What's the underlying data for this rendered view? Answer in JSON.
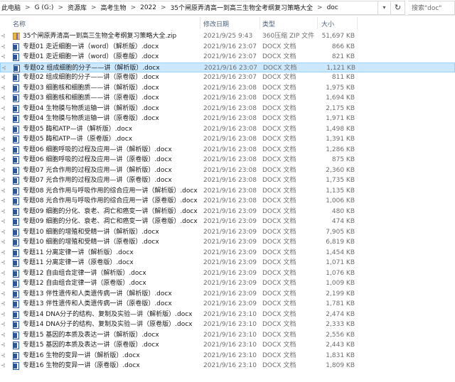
{
  "address": {
    "breadcrumbs": [
      "此电脑",
      "G (G:)",
      "资源库",
      "高考生物",
      "2022",
      "35个闸原弄清高一到高三生物全考纲复习策略大全",
      "doc"
    ],
    "separator": ">",
    "search_placeholder": "搜索\"doc\""
  },
  "columns": {
    "name": "名称",
    "date": "修改日期",
    "type": "类型",
    "size": "大小"
  },
  "files": [
    {
      "name": "35个闸原弄清高一到高三生物全考纲复习策略大全.zip",
      "date": "2021/9/25 9:43",
      "type": "360压缩 ZIP 文件",
      "size": "51,697 KB",
      "icon": "zip-icon",
      "state": "normal"
    },
    {
      "name": "专题01  走近细胞一讲（word）（解析版）.docx",
      "date": "2021/9/16 23:07",
      "type": "DOCX 文档",
      "size": "866 KB",
      "icon": "docx-icon",
      "state": "normal"
    },
    {
      "name": "专题01  走近细胞一讲（word）（原卷版）.docx",
      "date": "2021/9/16 23:07",
      "type": "DOCX 文档",
      "size": "821 KB",
      "icon": "docx-icon",
      "state": "normal"
    },
    {
      "name": "专题02 组成细胞的分子——讲（解析版）.docx",
      "date": "2021/9/16 23:07",
      "type": "DOCX 文档",
      "size": "1,121 KB",
      "icon": "docx-icon",
      "state": "selected"
    },
    {
      "name": "专题02 组成细胞的分子——讲（原卷版）.docx",
      "date": "2021/9/16 23:07",
      "type": "DOCX 文档",
      "size": "811 KB",
      "icon": "docx-icon",
      "state": "normal"
    },
    {
      "name": "专题03 细胞核和细胞质——讲（解析版）.docx",
      "date": "2021/9/16 23:08",
      "type": "DOCX 文档",
      "size": "1,975 KB",
      "icon": "docx-icon",
      "state": "normal"
    },
    {
      "name": "专题03 细胞核和细胞质——讲（原卷版）.docx",
      "date": "2021/9/16 23:08",
      "type": "DOCX 文档",
      "size": "1,694 KB",
      "icon": "docx-icon",
      "state": "normal"
    },
    {
      "name": "专题04 生物膜与物质运输一讲（解析版）.docx",
      "date": "2021/9/16 23:08",
      "type": "DOCX 文档",
      "size": "2,175 KB",
      "icon": "docx-icon",
      "state": "normal"
    },
    {
      "name": "专题04 生物膜与物质运输一讲（原卷版）.docx",
      "date": "2021/9/16 23:08",
      "type": "DOCX 文档",
      "size": "1,971 KB",
      "icon": "docx-icon",
      "state": "normal"
    },
    {
      "name": "专题05 酶和ATP—讲（解析版）.docx",
      "date": "2021/9/16 23:08",
      "type": "DOCX 文档",
      "size": "1,498 KB",
      "icon": "docx-icon",
      "state": "normal"
    },
    {
      "name": "专题05 酶和ATP—讲（原卷版）.docx",
      "date": "2021/9/16 23:08",
      "type": "DOCX 文档",
      "size": "1,391 KB",
      "icon": "docx-icon",
      "state": "normal"
    },
    {
      "name": "专题06 细胞呼吸的过程及应用—讲（解析版）.docx",
      "date": "2021/9/16 23:08",
      "type": "DOCX 文档",
      "size": "1,286 KB",
      "icon": "docx-icon",
      "state": "normal"
    },
    {
      "name": "专题06 细胞呼吸的过程及应用—讲（原卷版）.docx",
      "date": "2021/9/16 23:08",
      "type": "DOCX 文档",
      "size": "875 KB",
      "icon": "docx-icon",
      "state": "normal"
    },
    {
      "name": "专题07 光合作用的过程及应用—讲（解析版）.docx",
      "date": "2021/9/16 23:08",
      "type": "DOCX 文档",
      "size": "2,360 KB",
      "icon": "docx-icon",
      "state": "normal"
    },
    {
      "name": "专题07 光合作用的过程及应用—讲（原卷版）.docx",
      "date": "2021/9/16 23:08",
      "type": "DOCX 文档",
      "size": "1,735 KB",
      "icon": "docx-icon",
      "state": "normal"
    },
    {
      "name": "专题08 光合作用与呼吸作用的综合应用一讲（解析版）.docx",
      "date": "2021/9/16 23:08",
      "type": "DOCX 文档",
      "size": "1,135 KB",
      "icon": "docx-icon",
      "state": "normal"
    },
    {
      "name": "专题08 光合作用与呼吸作用的综合应用一讲（原卷版）.docx",
      "date": "2021/9/16 23:08",
      "type": "DOCX 文档",
      "size": "1,006 KB",
      "icon": "docx-icon",
      "state": "normal"
    },
    {
      "name": "专题09 细胞的分化、衰老、凋亡和癌变一讲（解析版）.docx",
      "date": "2021/9/16 23:09",
      "type": "DOCX 文档",
      "size": "480 KB",
      "icon": "docx-icon",
      "state": "normal"
    },
    {
      "name": "专题09 细胞的分化、衰老、凋亡和癌变一讲（原卷版）.docx",
      "date": "2021/9/16 23:09",
      "type": "DOCX 文档",
      "size": "474 KB",
      "icon": "docx-icon",
      "state": "normal"
    },
    {
      "name": "专题10 细胞的增殖和受精一讲（解析版）.docx",
      "date": "2021/9/16 23:09",
      "type": "DOCX 文档",
      "size": "7,905 KB",
      "icon": "docx-icon",
      "state": "normal"
    },
    {
      "name": "专题10 细胞的增殖和受精一讲（原卷版）.docx",
      "date": "2021/9/16 23:09",
      "type": "DOCX 文档",
      "size": "6,819 KB",
      "icon": "docx-icon",
      "state": "normal"
    },
    {
      "name": "专题11 分离定律一讲（解析版）.docx",
      "date": "2021/9/16 23:09",
      "type": "DOCX 文档",
      "size": "1,454 KB",
      "icon": "docx-icon",
      "state": "normal"
    },
    {
      "name": "专题11 分离定律一讲（原卷版）.docx",
      "date": "2021/9/16 23:09",
      "type": "DOCX 文档",
      "size": "1,071 KB",
      "icon": "docx-icon",
      "state": "normal"
    },
    {
      "name": "专题12 自由组合定律一讲（解析版）.docx",
      "date": "2021/9/16 23:09",
      "type": "DOCX 文档",
      "size": "1,076 KB",
      "icon": "docx-icon",
      "state": "normal"
    },
    {
      "name": "专题12 自由组合定律一讲（原卷版）.docx",
      "date": "2021/9/16 23:09",
      "type": "DOCX 文档",
      "size": "1,009 KB",
      "icon": "docx-icon",
      "state": "normal"
    },
    {
      "name": "专题13 伴性遗传和人类遗传病一讲（解析版）.docx",
      "date": "2021/9/16 23:09",
      "type": "DOCX 文档",
      "size": "2,199 KB",
      "icon": "docx-icon",
      "state": "normal"
    },
    {
      "name": "专题13 伴性遗传和人类遗传病一讲（原卷版）.docx",
      "date": "2021/9/16 23:09",
      "type": "DOCX 文档",
      "size": "1,781 KB",
      "icon": "docx-icon",
      "state": "normal"
    },
    {
      "name": "专题14 DNA分子的结构、复制及实验—讲（解析版）.docx",
      "date": "2021/9/16 23:10",
      "type": "DOCX 文档",
      "size": "2,474 KB",
      "icon": "docx-icon",
      "state": "normal"
    },
    {
      "name": "专题14 DNA分子的结构、复制及实验—讲（原卷版）.docx",
      "date": "2021/9/16 23:10",
      "type": "DOCX 文档",
      "size": "2,333 KB",
      "icon": "docx-icon",
      "state": "normal"
    },
    {
      "name": "专题15 基因的本质及表达一讲（解析版）.docx",
      "date": "2021/9/16 23:10",
      "type": "DOCX 文档",
      "size": "2,556 KB",
      "icon": "docx-icon",
      "state": "normal"
    },
    {
      "name": "专题15 基因的本质及表达一讲（原卷版）.docx",
      "date": "2021/9/16 23:10",
      "type": "DOCX 文档",
      "size": "2,443 KB",
      "icon": "docx-icon",
      "state": "normal"
    },
    {
      "name": "专题16 生物的变异一讲（解析版）.docx",
      "date": "2021/9/16 23:10",
      "type": "DOCX 文档",
      "size": "1,831 KB",
      "icon": "docx-icon",
      "state": "normal"
    },
    {
      "name": "专题16 生物的变异一讲（原卷版）.docx",
      "date": "2021/9/16 23:10",
      "type": "DOCX 文档",
      "size": "1,809 KB",
      "icon": "docx-icon",
      "state": "normal"
    }
  ]
}
